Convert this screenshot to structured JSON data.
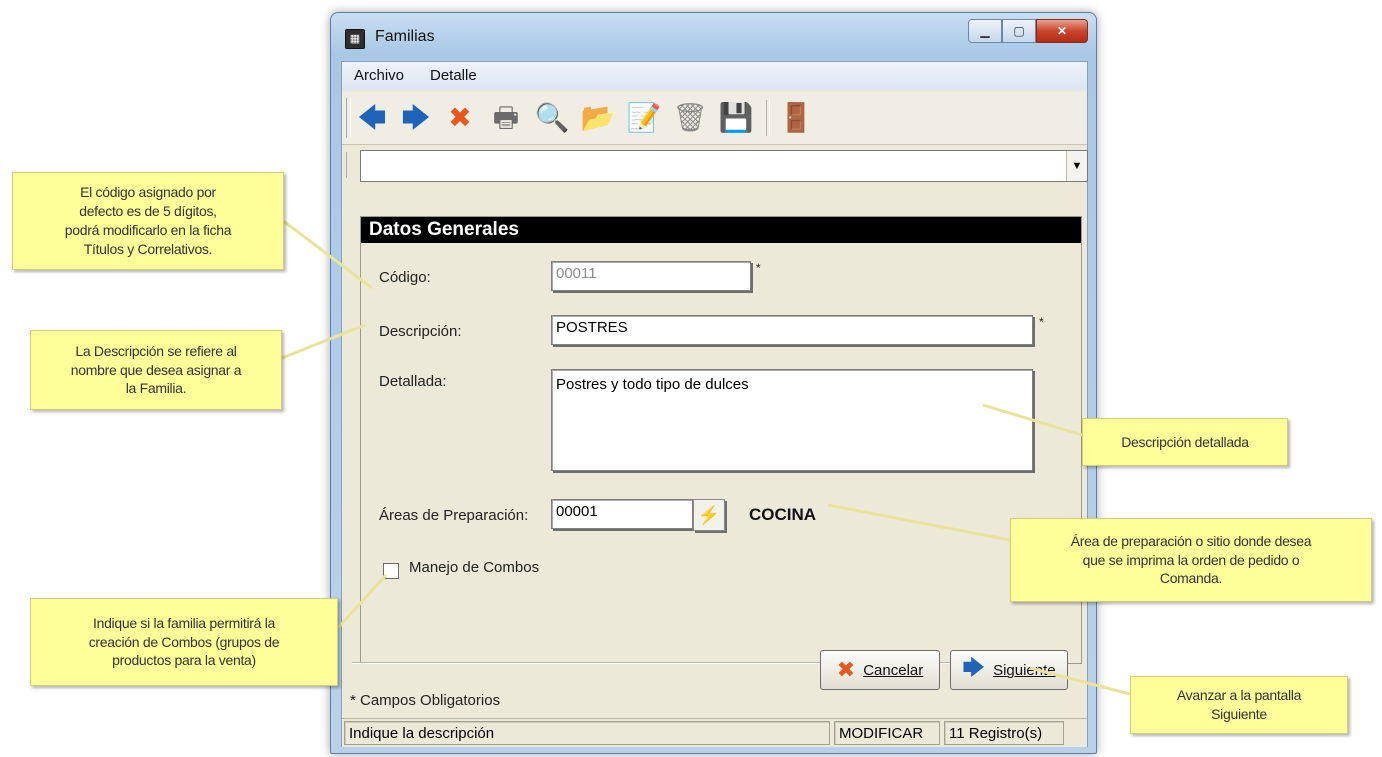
{
  "window": {
    "title": "Familias",
    "app_icon_glyph": "▦"
  },
  "menu": [
    {
      "label": "Archivo"
    },
    {
      "label": "Detalle"
    }
  ],
  "toolbar": {
    "buttons": [
      {
        "icon": "arrow-left-icon",
        "glyph": "🡄",
        "color": "#1f64b8"
      },
      {
        "icon": "arrow-right-icon",
        "glyph": "🡆",
        "color": "#1f64b8"
      },
      {
        "icon": "delete-x-icon",
        "glyph": "✖",
        "color": "#e8571b"
      },
      {
        "icon": "printer-icon",
        "glyph": "🖶",
        "color": "#6b6b6b"
      },
      {
        "icon": "search-icon",
        "glyph": "🔍",
        "color": "#8a8a8a"
      },
      {
        "icon": "open-folder-icon",
        "glyph": "📂",
        "color": "#8a8a8a"
      },
      {
        "icon": "edit-document-icon",
        "glyph": "📝",
        "color": "#8a8a8a"
      },
      {
        "icon": "trash-icon",
        "glyph": "🗑",
        "color": "#8a8a8a"
      },
      {
        "icon": "save-disk-icon",
        "glyph": "💾",
        "color": "#7a2b8a"
      },
      {
        "icon": "exit-door-icon",
        "glyph": "🚪",
        "color": "#c85a1a"
      }
    ]
  },
  "search_combo": {
    "value": ""
  },
  "form": {
    "header": "Datos Generales",
    "codigo_label": "Código:",
    "codigo_value": "00011",
    "descripcion_label": "Descripción:",
    "descripcion_value": "POSTRES",
    "detallada_label": "Detallada:",
    "detallada_value": "Postres y todo tipo de dulces",
    "areas_label": "Áreas de Preparación:",
    "areas_value": "00001",
    "area_name": "COCINA",
    "combos_label": "Manejo de Combos",
    "combos_checked": false,
    "required_mark": "*"
  },
  "actions": {
    "cancel_label": "Cancelar",
    "next_label": "Siguiente"
  },
  "footnote": "* Campos Obligatorios",
  "status": {
    "message": "Indique la descripción",
    "mode": "MODIFICAR",
    "records": "11 Registro(s)"
  },
  "callouts": {
    "codigo": [
      "El código asignado por",
      "defecto es de 5 dígitos,",
      "podrá modificarlo en la ficha",
      "Títulos y Correlativos."
    ],
    "descripcion": [
      "La Descripción se refiere al",
      "nombre que desea asignar a",
      "la Familia."
    ],
    "combos": [
      "Indique si la familia permitirá la",
      "creación de Combos (grupos de",
      "productos para la venta)"
    ],
    "detallada": [
      "Descripción detallada"
    ],
    "area": [
      "Área de preparación o sitio donde desea",
      "que se imprima la orden de pedido o",
      "Comanda."
    ],
    "siguiente": [
      "Avanzar a la pantalla",
      "Siguiente"
    ]
  },
  "colors": {
    "callout_bg": "#ffff99",
    "header_bg": "#000000",
    "accent_blue": "#1f64b8",
    "accent_orange": "#e8571b"
  }
}
